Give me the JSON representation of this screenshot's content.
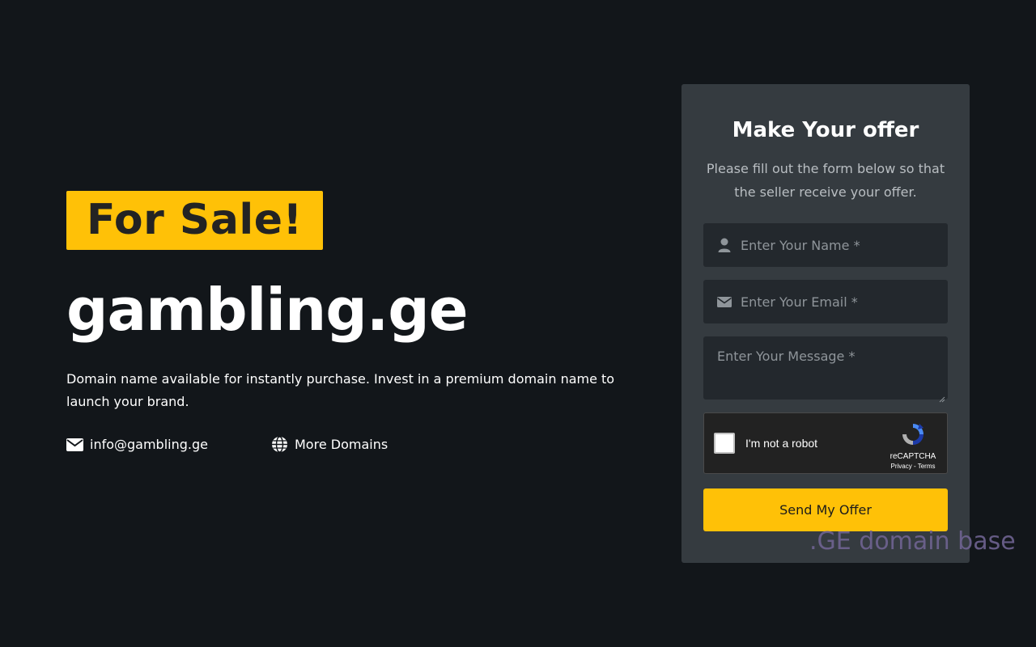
{
  "hero": {
    "badge": "For Sale!",
    "domain": "gambling.ge",
    "description": "Domain name available for instantly purchase. Invest in a premium domain name to launch your brand.",
    "email": "info@gambling.ge",
    "more_domains": "More Domains"
  },
  "form": {
    "title": "Make Your offer",
    "subtitle": "Please fill out the form below so that the seller receive your offer.",
    "name_placeholder": "Enter Your Name *",
    "email_placeholder": "Enter Your Email *",
    "message_placeholder": "Enter Your Message *",
    "recaptcha": {
      "label": "I'm not a robot",
      "brand": "reCAPTCHA",
      "links": "Privacy - Terms"
    },
    "submit_label": "Send My Offer"
  },
  "watermark": ".GE domain base",
  "colors": {
    "background": "#12161a",
    "accent": "#ffc107",
    "card": "#353b40",
    "field": "#23282d"
  }
}
